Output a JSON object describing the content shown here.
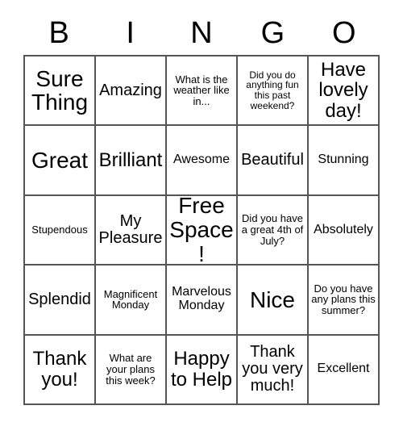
{
  "header": {
    "letters": [
      "B",
      "I",
      "N",
      "G",
      "O"
    ]
  },
  "grid": {
    "rows": [
      [
        {
          "text": "Sure Thing",
          "size": "xl"
        },
        {
          "text": "Amazing",
          "size": "md"
        },
        {
          "text": "What is the weather like in...",
          "size": "xs"
        },
        {
          "text": "Did you do anything fun this past weekend?",
          "size": "xxs"
        },
        {
          "text": "Have lovely day!",
          "size": "lg"
        }
      ],
      [
        {
          "text": "Great",
          "size": "xl"
        },
        {
          "text": "Brilliant",
          "size": "lg"
        },
        {
          "text": "Awesome",
          "size": "sm"
        },
        {
          "text": "Beautiful",
          "size": "md"
        },
        {
          "text": "Stunning",
          "size": "sm"
        }
      ],
      [
        {
          "text": "Stupendous",
          "size": "xs"
        },
        {
          "text": "My Pleasure",
          "size": "md"
        },
        {
          "text": "Free Space!",
          "size": "xl"
        },
        {
          "text": "Did you have a great 4th of July?",
          "size": "xs"
        },
        {
          "text": "Absolutely",
          "size": "sm"
        }
      ],
      [
        {
          "text": "Splendid",
          "size": "md"
        },
        {
          "text": "Magnificent Monday",
          "size": "xs"
        },
        {
          "text": "Marvelous Monday",
          "size": "sm"
        },
        {
          "text": "Nice",
          "size": "xl"
        },
        {
          "text": "Do you have any plans this summer?",
          "size": "xs"
        }
      ],
      [
        {
          "text": "Thank you!",
          "size": "lg"
        },
        {
          "text": "What are your plans this week?",
          "size": "xs"
        },
        {
          "text": "Happy to Help",
          "size": "lg"
        },
        {
          "text": "Thank you very much!",
          "size": "md"
        },
        {
          "text": "Excellent",
          "size": "sm"
        }
      ]
    ]
  }
}
